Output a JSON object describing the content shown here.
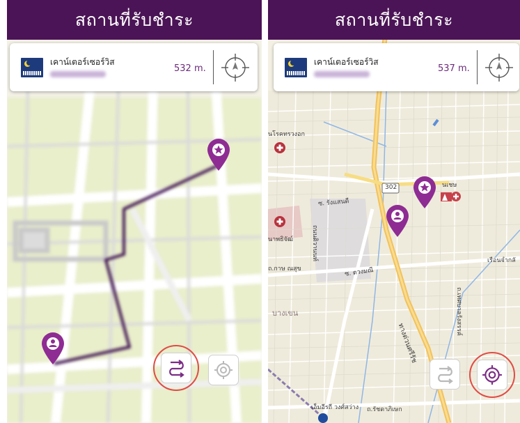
{
  "header": {
    "title": "สถานที่รับชำระ"
  },
  "left_view": {
    "service": {
      "name": "เคาน์เตอร์เซอร์วิส",
      "distance": "532 m."
    }
  },
  "right_view": {
    "service": {
      "name": "เคาน์เตอร์เซอร์วิส",
      "distance": "537 m."
    },
    "map_labels": {
      "hospital": "นโรคทรวงอก",
      "road_302": "302",
      "mall": "นเชษ",
      "soi_1": "ซ. รังแสนดี",
      "soi_2": "ซ. ดวงมณี",
      "tiwanon": "ถนนติวานนท์",
      "expressway": "ทางด่วนศรีรัช",
      "bangkhen": "บางเขน",
      "kaset": "ถ.กาษ ณสุข",
      "home": "เรือนจำกลั",
      "hospital2": "นาพธิจัฒ์",
      "village": "เอ็มอีรถี วงศ์สว่าง",
      "temple": "ถ.รัชดาภิเษก",
      "bangsue": "ถ.เทศบาลรังสรรค์"
    }
  },
  "buttons": {
    "route_icon": "route-swap-icon",
    "locate_icon": "crosshair-icon"
  },
  "colors": {
    "brand": "#4b1456",
    "pin": "#8e2c93",
    "route": "#3e1251",
    "highlight": "#e04b45"
  }
}
